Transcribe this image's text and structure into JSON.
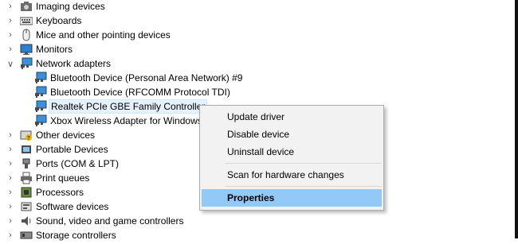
{
  "tree": {
    "items": [
      {
        "label": "Imaging devices",
        "icon": "camera-icon",
        "expanded": false
      },
      {
        "label": "Keyboards",
        "icon": "keyboard-icon",
        "expanded": false
      },
      {
        "label": "Mice and other pointing devices",
        "icon": "mouse-icon",
        "expanded": false
      },
      {
        "label": "Monitors",
        "icon": "monitor-icon",
        "expanded": false
      },
      {
        "label": "Network adapters",
        "icon": "network-adapter-icon",
        "expanded": true
      },
      {
        "label": "Bluetooth Device (Personal Area Network) #9",
        "icon": "network-adapter-icon"
      },
      {
        "label": "Bluetooth Device (RFCOMM Protocol TDI)",
        "icon": "network-adapter-icon"
      },
      {
        "label": "Realtek PCIe GBE Family Controller",
        "icon": "network-adapter-icon",
        "selected": true
      },
      {
        "label": "Xbox Wireless Adapter for Windows",
        "icon": "network-adapter-icon"
      },
      {
        "label": "Other devices",
        "icon": "other-device-icon",
        "expanded": false
      },
      {
        "label": "Portable Devices",
        "icon": "portable-device-icon",
        "expanded": false
      },
      {
        "label": "Ports (COM & LPT)",
        "icon": "port-icon",
        "expanded": false
      },
      {
        "label": "Print queues",
        "icon": "printer-icon",
        "expanded": false
      },
      {
        "label": "Processors",
        "icon": "processor-icon",
        "expanded": false
      },
      {
        "label": "Software devices",
        "icon": "software-device-icon",
        "expanded": false
      },
      {
        "label": "Sound, video and game controllers",
        "icon": "speaker-icon",
        "expanded": false
      },
      {
        "label": "Storage controllers",
        "icon": "storage-controller-icon",
        "expanded": false
      }
    ]
  },
  "context_menu": {
    "items": [
      {
        "label": "Update driver"
      },
      {
        "label": "Disable device"
      },
      {
        "label": "Uninstall device"
      },
      {
        "label": "Scan for hardware changes"
      },
      {
        "label": "Properties",
        "highlighted": true
      }
    ]
  },
  "colors": {
    "menu_highlight": "#91c9f7",
    "selection": "#e5f1fb",
    "menu_bg": "#f2f2f2"
  }
}
